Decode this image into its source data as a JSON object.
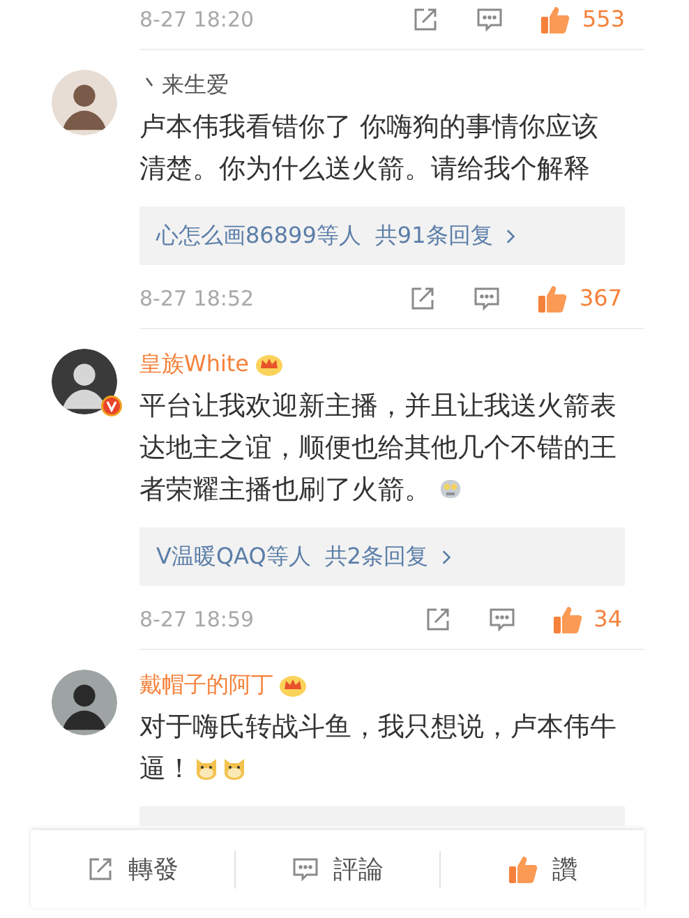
{
  "top_meta": {
    "time": "8-27 18:20",
    "likes": "553"
  },
  "comments": [
    {
      "name": "丶来生爱",
      "vip": false,
      "verified": false,
      "text": "卢本伟我看错你了 你嗨狗的事情你应该清楚。你为什么送火箭。请给我个解释",
      "reply_bar": {
        "who": "心怎么画86899等人",
        "count": "共91条回复"
      },
      "time": "8-27 18:52",
      "likes": "367"
    },
    {
      "name": "皇族White",
      "vip": true,
      "verified": true,
      "text": "平台让我欢迎新主播，并且让我送火箭表达地主之谊，顺便也给其他几个不错的王者荣耀主播也刷了火箭。",
      "trailing_icons": [
        {
          "kind": "robot"
        }
      ],
      "reply_bar": {
        "who": "V温暖QAQ等人",
        "count": "共2条回复"
      },
      "time": "8-27 18:59",
      "likes": "34"
    },
    {
      "name": "戴帽子的阿丁",
      "vip": true,
      "verified": false,
      "text": "对于嗨氏转战斗鱼，我只想说，卢本伟牛逼！",
      "trailing_icons": [
        {
          "kind": "doge"
        },
        {
          "kind": "doge"
        }
      ],
      "reply_bar_covered": true
    }
  ],
  "bottom_bar": [
    {
      "kind": "repost",
      "label": "轉發"
    },
    {
      "kind": "comment",
      "label": "評論"
    },
    {
      "kind": "like",
      "label": "讚"
    }
  ]
}
